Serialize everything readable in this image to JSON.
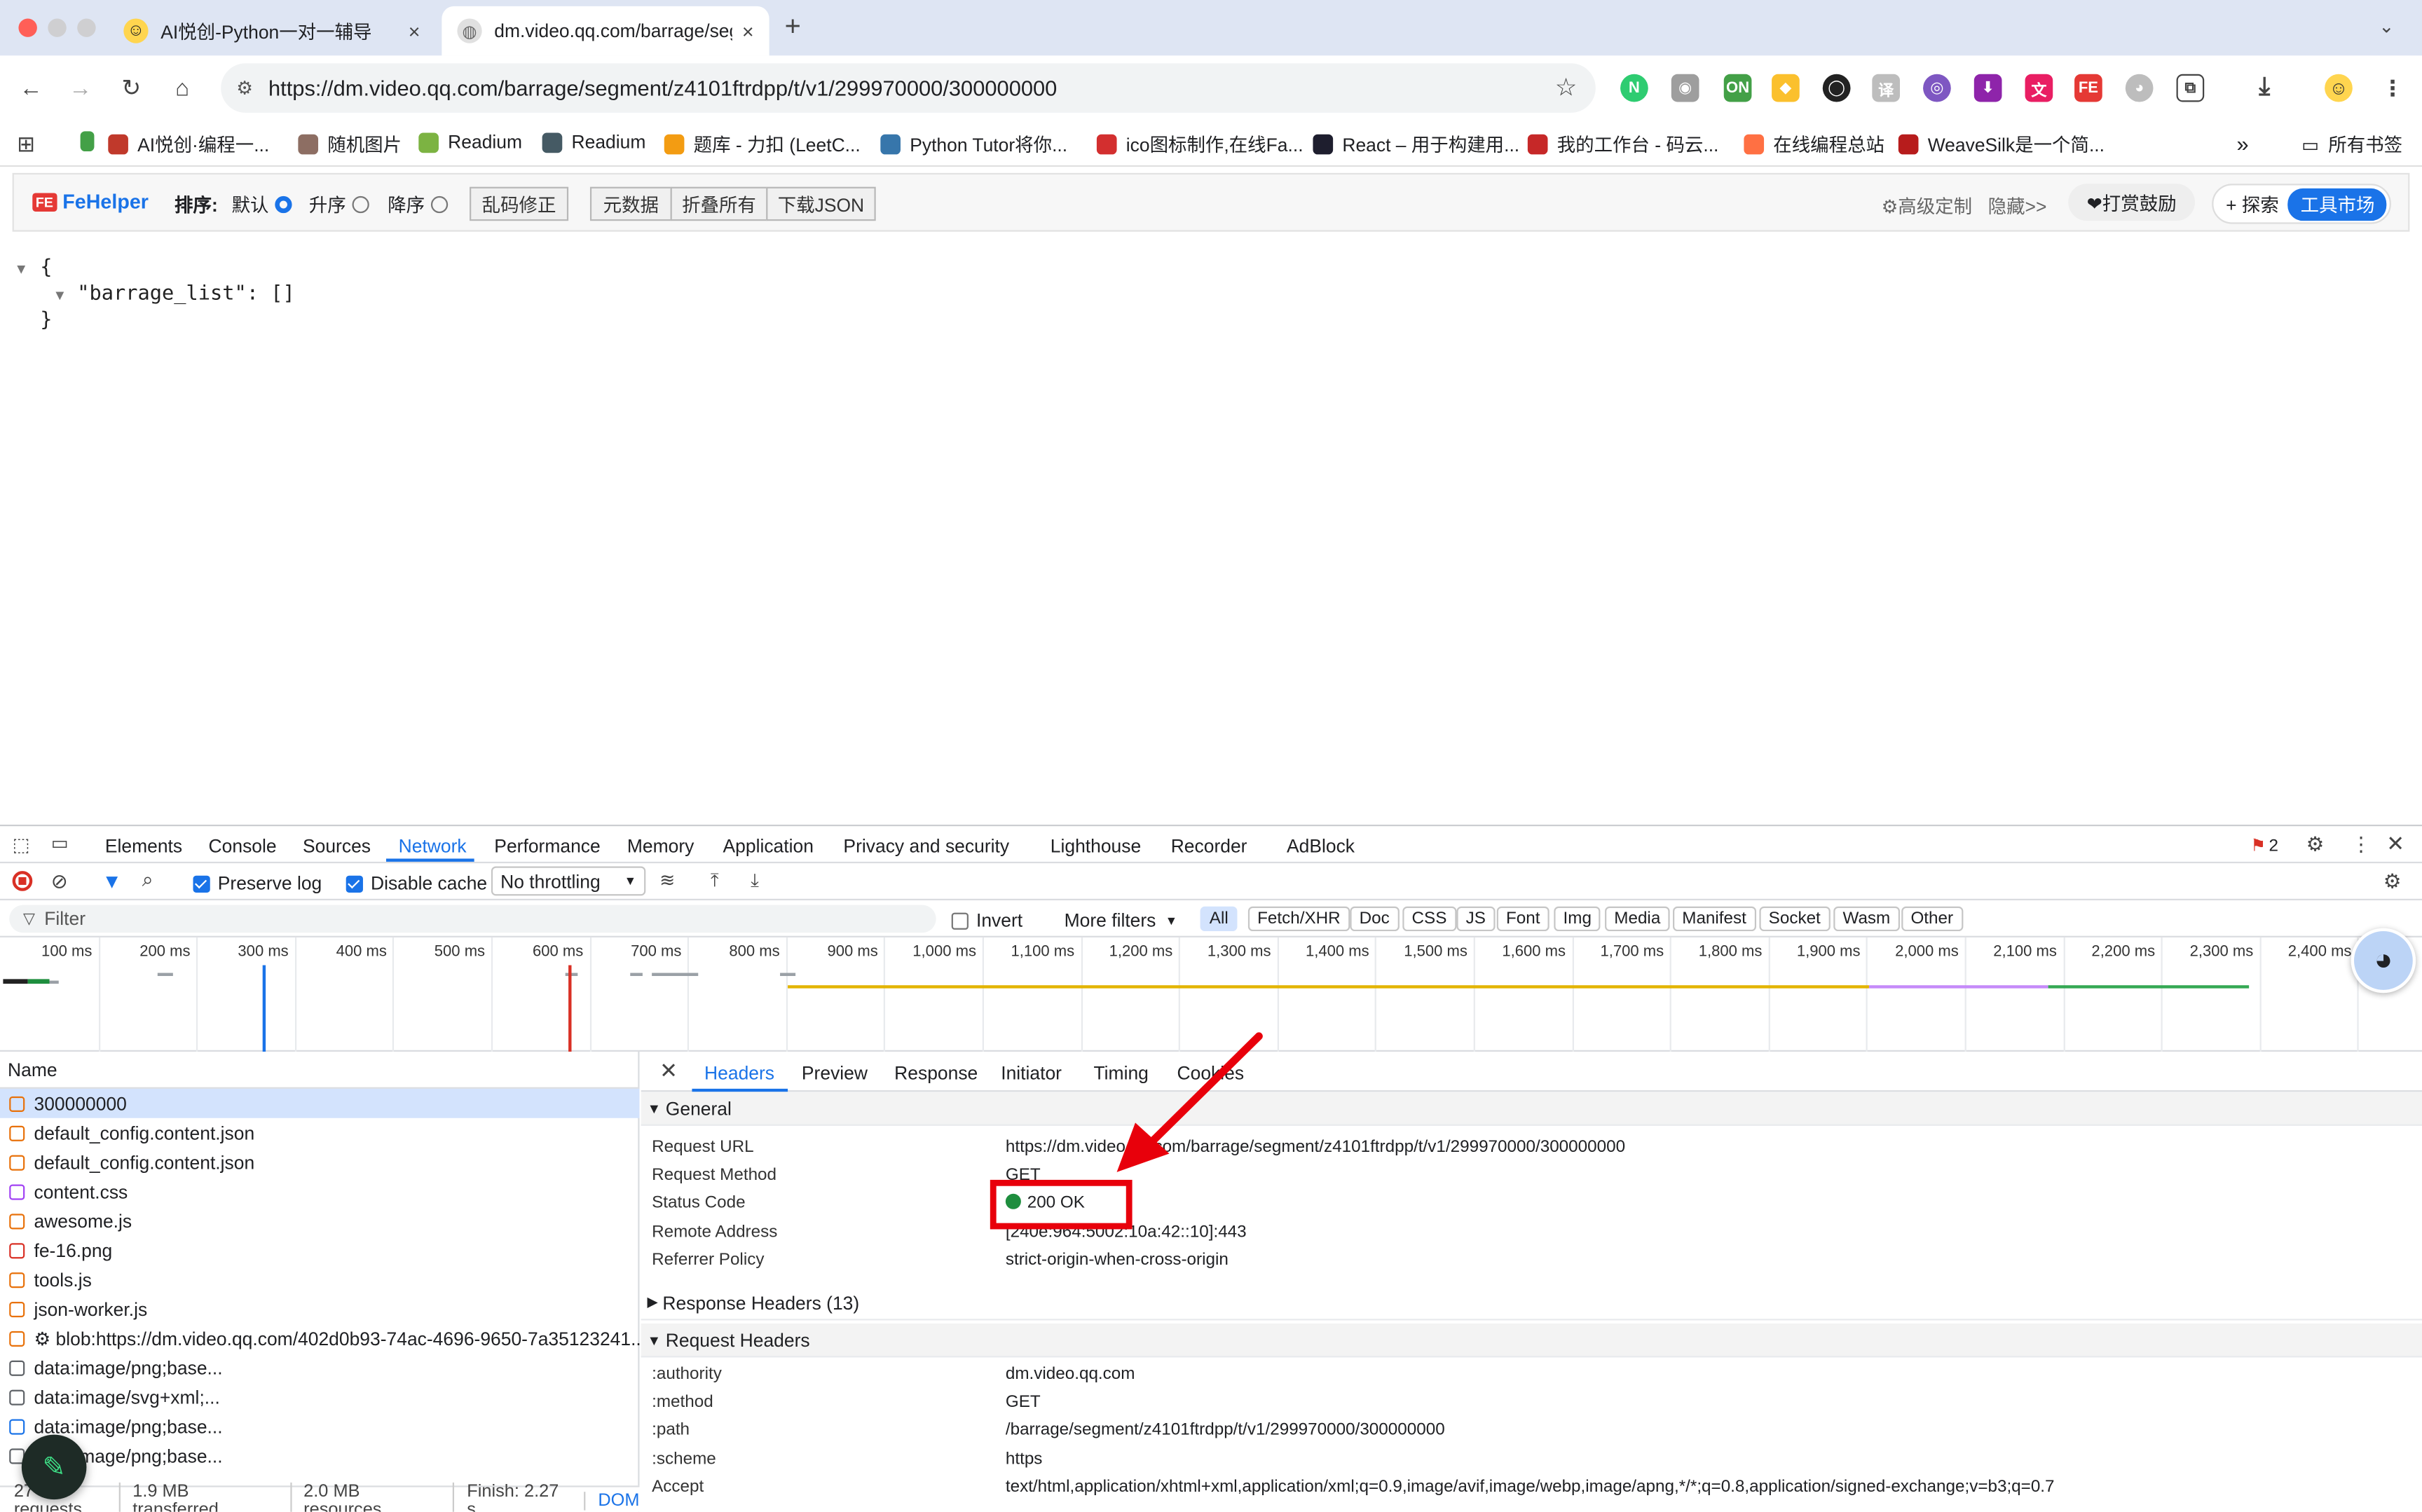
{
  "tabs": [
    {
      "title": "AI悦创-Python一对一辅导",
      "close": "×"
    },
    {
      "title": "dm.video.qq.com/barrage/seg",
      "close": "×"
    }
  ],
  "new_tab": "+",
  "address": {
    "url": "https://dm.video.qq.com/barrage/segment/z4101ftrdpp/t/v1/299970000/300000000"
  },
  "bookmarks": [
    {
      "label": "AI悦创·编程一...",
      "color": "#c0392b"
    },
    {
      "label": "随机图片",
      "color": "#8d6e63"
    },
    {
      "label": "Readium",
      "color": "#7cb342"
    },
    {
      "label": "Readium",
      "color": "#455a64"
    },
    {
      "label": "题库 - 力扣 (LeetC...",
      "color": "#f39c12"
    },
    {
      "label": "Python Tutor将你...",
      "color": "#3776ab"
    },
    {
      "label": "ico图标制作,在线Fa...",
      "color": "#d32f2f"
    },
    {
      "label": "React – 用于构建用...",
      "color": "#1e1e2e"
    },
    {
      "label": "我的工作台 - 码云...",
      "color": "#c62828"
    },
    {
      "label": "在线编程总站",
      "color": "#ff7043"
    },
    {
      "label": "WeaveSilk是一个简...",
      "color": "#b71c1c"
    }
  ],
  "bookmarks_more": "»",
  "all_bookmarks": "所有书签",
  "fehelper": {
    "logo": "FeHelper",
    "sort_label": "排序:",
    "sort_default": "默认",
    "sort_asc": "升序",
    "sort_desc": "降序",
    "fix_garbled": "乱码修正",
    "metadata": "元数据",
    "fold_all": "折叠所有",
    "download_json": "下载JSON",
    "advanced": "⚙高级定制",
    "hide": "隐藏>>",
    "donate": "❤打赏鼓励",
    "explore": "+ 探索",
    "market": "工具市场"
  },
  "json_view": {
    "open_brace": "{",
    "line": "\"barrage_list\": []",
    "close_brace": "}"
  },
  "devtools": {
    "tabs": [
      "Elements",
      "Console",
      "Sources",
      "Network",
      "Performance",
      "Memory",
      "Application",
      "Privacy and security",
      "Lighthouse",
      "Recorder",
      "AdBlock"
    ],
    "active_tab": "Network",
    "error_count": "2",
    "preserve_log": "Preserve log",
    "disable_cache": "Disable cache",
    "throttling": "No throttling",
    "filter_placeholder": "Filter",
    "invert": "Invert",
    "more_filters": "More filters",
    "filter_types": [
      "All",
      "Fetch/XHR",
      "Doc",
      "CSS",
      "JS",
      "Font",
      "Img",
      "Media",
      "Manifest",
      "Socket",
      "Wasm",
      "Other"
    ],
    "timeline_ticks": [
      "100 ms",
      "200 ms",
      "300 ms",
      "400 ms",
      "500 ms",
      "600 ms",
      "700 ms",
      "800 ms",
      "900 ms",
      "1,000 ms",
      "1,100 ms",
      "1,200 ms",
      "1,300 ms",
      "1,400 ms",
      "1,500 ms",
      "1,600 ms",
      "1,700 ms",
      "1,800 ms",
      "1,900 ms",
      "2,000 ms",
      "2,100 ms",
      "2,200 ms",
      "2,300 ms",
      "2,400 ms"
    ],
    "name_header": "Name",
    "requests": [
      {
        "name": "300000000",
        "color": "#e8710a"
      },
      {
        "name": "default_config.content.json",
        "color": "#e8710a"
      },
      {
        "name": "default_config.content.json",
        "color": "#e8710a"
      },
      {
        "name": "content.css",
        "color": "#a142f4"
      },
      {
        "name": "awesome.js",
        "color": "#e8710a"
      },
      {
        "name": "fe-16.png",
        "color": "#d93025"
      },
      {
        "name": "tools.js",
        "color": "#e8710a"
      },
      {
        "name": "json-worker.js",
        "color": "#e8710a"
      },
      {
        "name": "⚙ blob:https://dm.video.qq.com/402d0b93-74ac-4696-9650-7a35123241...",
        "color": "#e8710a"
      },
      {
        "name": "data:image/png;base...",
        "color": "#5f6368"
      },
      {
        "name": "data:image/svg+xml;...",
        "color": "#5f6368"
      },
      {
        "name": "data:image/png;base...",
        "color": "#1a73e8"
      },
      {
        "name": "data:image/png;base...",
        "color": "#5f6368"
      }
    ],
    "status": {
      "requests": "27 requests",
      "transferred": "1.9 MB transferred",
      "resources": "2.0 MB resources",
      "finish": "Finish: 2.27 s",
      "dom": "DOM"
    },
    "detail_tabs": [
      "Headers",
      "Preview",
      "Response",
      "Initiator",
      "Timing",
      "Cookies"
    ],
    "general_title": "General",
    "general": [
      {
        "k": "Request URL",
        "v": "https://dm.video.qq.com/barrage/segment/z4101ftrdpp/t/v1/299970000/300000000"
      },
      {
        "k": "Request Method",
        "v": "GET"
      },
      {
        "k": "Status Code",
        "v": "200 OK"
      },
      {
        "k": "Remote Address",
        "v": "[240e:964:5002:10a:42::10]:443"
      },
      {
        "k": "Referrer Policy",
        "v": "strict-origin-when-cross-origin"
      }
    ],
    "response_headers_title": "Response Headers (13)",
    "request_headers_title": "Request Headers",
    "request_headers": [
      {
        "k": ":authority",
        "v": "dm.video.qq.com"
      },
      {
        "k": ":method",
        "v": "GET"
      },
      {
        "k": ":path",
        "v": "/barrage/segment/z4101ftrdpp/t/v1/299970000/300000000"
      },
      {
        "k": ":scheme",
        "v": "https"
      },
      {
        "k": "Accept",
        "v": "text/html,application/xhtml+xml,application/xml;q=0.9,image/avif,image/webp,image/apng,*/*;q=0.8,application/signed-exchange;v=b3;q=0.7"
      }
    ]
  },
  "colors": {
    "accent": "#1a73e8",
    "highlight": "#e8000b",
    "status_ok": "#1e8e3e"
  }
}
